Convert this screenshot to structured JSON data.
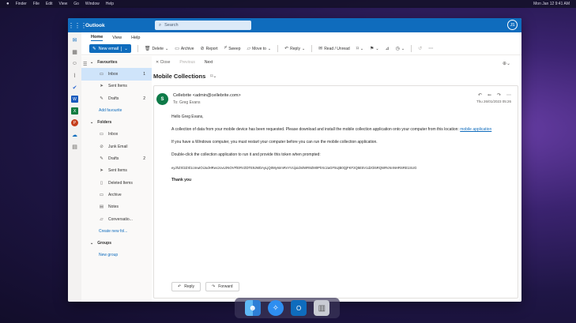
{
  "menubar": {
    "items": [
      "Finder",
      "File",
      "Edit",
      "View",
      "Go",
      "Window",
      "Help"
    ],
    "clock": "Mon Jan 12   9:41 AM"
  },
  "titlebar": {
    "app_title": "Outlook",
    "search_placeholder": "Search",
    "avatar_initials": "JS"
  },
  "ribbon": {
    "tabs": [
      "Home",
      "View",
      "Help"
    ],
    "new_email": "New email",
    "actions": [
      "Delete",
      "Archive",
      "Report",
      "Sweep",
      "Move to",
      "Reply",
      "Read / Unread"
    ]
  },
  "folders": {
    "favourites_header": "Favourites",
    "favourites": [
      {
        "label": "Inbox",
        "count": "1",
        "icon": "inbox-icon"
      },
      {
        "label": "Sent Items",
        "count": "",
        "icon": "send-icon"
      },
      {
        "label": "Drafts",
        "count": "2",
        "icon": "draft-icon"
      }
    ],
    "add_favourite": "Add favourite",
    "folders_header": "Folders",
    "items": [
      {
        "label": "Inbox",
        "count": "",
        "icon": "inbox-icon"
      },
      {
        "label": "Junk Email",
        "count": "",
        "icon": "junk-icon"
      },
      {
        "label": "Drafts",
        "count": "2",
        "icon": "draft-icon"
      },
      {
        "label": "Sent Items",
        "count": "",
        "icon": "send-icon"
      },
      {
        "label": "Deleted Items",
        "count": "",
        "icon": "trash-icon"
      },
      {
        "label": "Archive",
        "count": "",
        "icon": "archive-icon"
      },
      {
        "label": "Notes",
        "count": "",
        "icon": "note-icon"
      },
      {
        "label": "Conversatio...",
        "count": "",
        "icon": "folder-icon"
      }
    ],
    "create_folder": "Create new fol...",
    "groups_header": "Groups",
    "new_group": "New group"
  },
  "reading": {
    "close": "Close",
    "previous": "Previous",
    "next": "Next",
    "subject": "Mobile Collections",
    "sender_initial": "S",
    "sender": "Cellebrite <admin@cellebrite.com>",
    "to": "To:  Greg Evans",
    "date": "Thu 26/01/2023 05:26",
    "greeting": "Hello Greg Evans,",
    "para1": "A collection of data from your mobile device has been requested. Please download and install the mobile collection application onto your computer from this location: ",
    "link": "mobile application",
    "para2": "If you have a Windows computer, you must restart your computer before you can run the mobile collection application.",
    "para3": "Double-click the collection application to run it and provide this token when prompted:",
    "token": "eyJhZXl2ZXl1cmwiOiJodHRwczovL0NOVFlERVZDTE9JMDAyLjQ0MyIsImRvYVcijoidmlWR9ZM0PlrXc2aGF5UjB0QjFKF2Q5E5V1dzOi5RQWRcNnNHRSRE1SUG",
    "thanks": "Thank you",
    "reply": "Reply",
    "forward": "Forward"
  }
}
